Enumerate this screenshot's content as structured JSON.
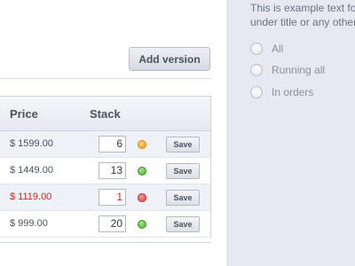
{
  "main": {
    "add_version_label": "Add version",
    "table": {
      "headers": {
        "price": "Price",
        "stack": "Stack"
      },
      "rows": [
        {
          "price": "$ 1599.00",
          "stack": "6",
          "status": "orange",
          "save": "Save",
          "highlight": false
        },
        {
          "price": "$ 1449.00",
          "stack": "13",
          "status": "green",
          "save": "Save",
          "highlight": false
        },
        {
          "price": "$ 1119.00",
          "stack": "1",
          "status": "red",
          "save": "Save",
          "highlight": true
        },
        {
          "price": "$ 999.00",
          "stack": "20",
          "status": "green",
          "save": "Save",
          "highlight": false
        }
      ]
    }
  },
  "sidebar": {
    "description_lines": [
      "This is example text fo",
      "under title or any other"
    ],
    "filters": [
      {
        "label": "All"
      },
      {
        "label": "Running all"
      },
      {
        "label": "In orders"
      }
    ]
  },
  "colors": {
    "sidebar_bg": "#e6e9f2",
    "price_red": "#d61f1f",
    "status_orange": "#f29b1d",
    "status_green": "#4cae2e",
    "status_red": "#e23a3a"
  }
}
